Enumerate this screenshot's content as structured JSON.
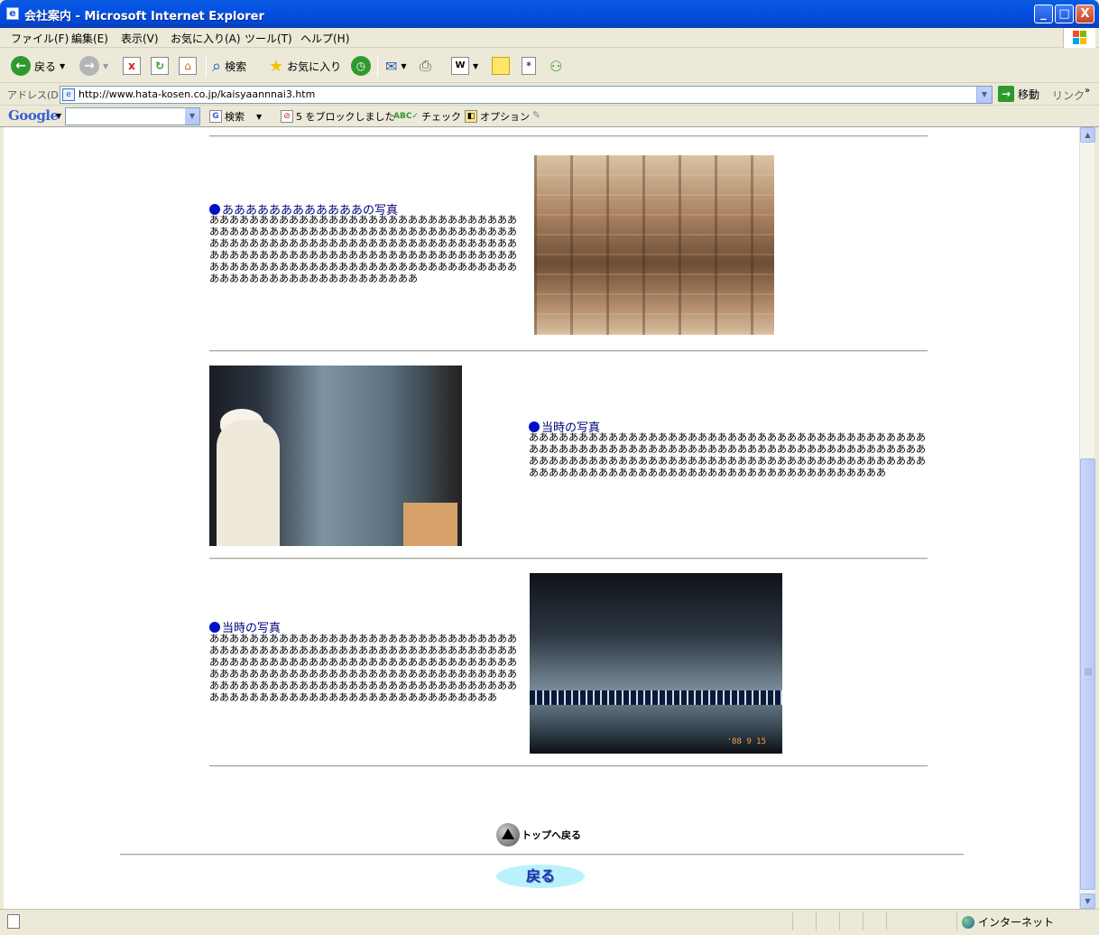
{
  "window": {
    "title": "会社案内 - Microsoft Internet Explorer",
    "buttons": {
      "minimize": "_",
      "maximize": "□",
      "close": "X"
    }
  },
  "menu": [
    "ファイル(F)",
    "編集(E)",
    "表示(V)",
    "お気に入り(A)",
    "ツール(T)",
    "ヘルプ(H)"
  ],
  "toolbar": {
    "back_label": "戻る",
    "search_label": "検索",
    "favorites_label": "お気に入り"
  },
  "address": {
    "label": "アドレス(D)",
    "url": "http://www.hata-kosen.co.jp/kaisyaannnai3.htm",
    "go_label": "移動",
    "links_label": "リンク"
  },
  "googlebar": {
    "logo": "Google",
    "search_value": "",
    "search_label": "検索",
    "blocked_label": "5 をブロックしました",
    "check_label": "チェック",
    "options_label": "オプション"
  },
  "content": {
    "entries": [
      {
        "title": "ああああああああああああの写真",
        "body": "ああああああああああああああああああああああああああああああああああああああああああああああああああああああああああああああああああああああああああああああああああああああああああああああああああああああああああああああああああああああああああああああああああああああああああああああああああああああああああああああああああああああああああああああああ"
      },
      {
        "title": "当時の写真",
        "body": "ああああああああああああああああああああああああああああああああああああああああああああああああああああああああああああああああああああああああああああああああああああああああああああああああああああああああああああああああああああああああああああああああああああああああああああああああああああああああああああ"
      },
      {
        "title": "当時の写真",
        "body": "ああああああああああああああああああああああああああああああああああああああああああああああああああああああああああああああああああああああああああああああああああああああああああああああああああああああああああああああああああああああああああああああああああああああああああああああああああああああああああああああああああああああああああああああああああああああああ"
      }
    ],
    "photo3_stamp": "'88  9  15",
    "top_link": "トップへ戻る",
    "back_button": "戻る"
  },
  "status": {
    "zone": "インターネット"
  },
  "colors": {
    "link": "#000080",
    "bullet": "#0010c8",
    "back_button_bg": "#b9f2fb"
  }
}
